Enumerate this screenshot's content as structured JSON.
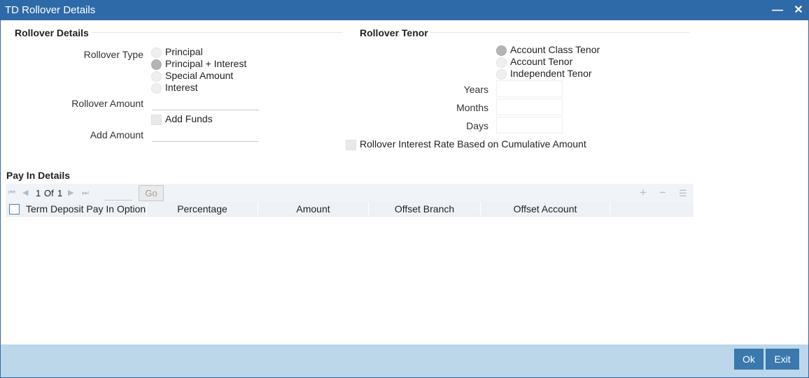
{
  "window": {
    "title": "TD Rollover Details",
    "minimize_icon": "minimize-icon",
    "close_icon": "close-icon"
  },
  "rollover_details": {
    "title": "Rollover Details",
    "rollover_type_label": "Rollover Type",
    "rollover_type_options": [
      "Principal",
      "Principal + Interest",
      "Special Amount",
      "Interest"
    ],
    "rollover_type_selected": "Principal + Interest",
    "rollover_amount_label": "Rollover Amount",
    "rollover_amount_value": "",
    "add_funds_label": "Add Funds",
    "add_funds_checked": false,
    "add_amount_label": "Add Amount",
    "add_amount_value": ""
  },
  "rollover_tenor": {
    "title": "Rollover Tenor",
    "tenor_options": [
      "Account Class Tenor",
      "Account Tenor",
      "Independent Tenor"
    ],
    "tenor_selected": "Account Class Tenor",
    "years_label": "Years",
    "months_label": "Months",
    "days_label": "Days",
    "years_value": "",
    "months_value": "",
    "days_value": "",
    "cumulative_rate_label": "Rollover Interest Rate Based on Cumulative Amount",
    "cumulative_rate_checked": false
  },
  "pay_in_details": {
    "title": "Pay In Details",
    "pager": {
      "current": "1",
      "of_label": "Of",
      "total": "1",
      "go_label": "Go"
    },
    "toolbar_icons": [
      "add-row-icon",
      "delete-row-icon",
      "view-columns-icon"
    ],
    "columns": [
      "Term Deposit Pay In Option",
      "Percentage",
      "Amount",
      "Offset Branch",
      "Offset Account"
    ],
    "rows": []
  },
  "footer": {
    "ok_label": "Ok",
    "exit_label": "Exit"
  },
  "colors": {
    "titlebar": "#2f6aa8",
    "footer": "#bdd7ea",
    "button": "#3a78ad"
  }
}
